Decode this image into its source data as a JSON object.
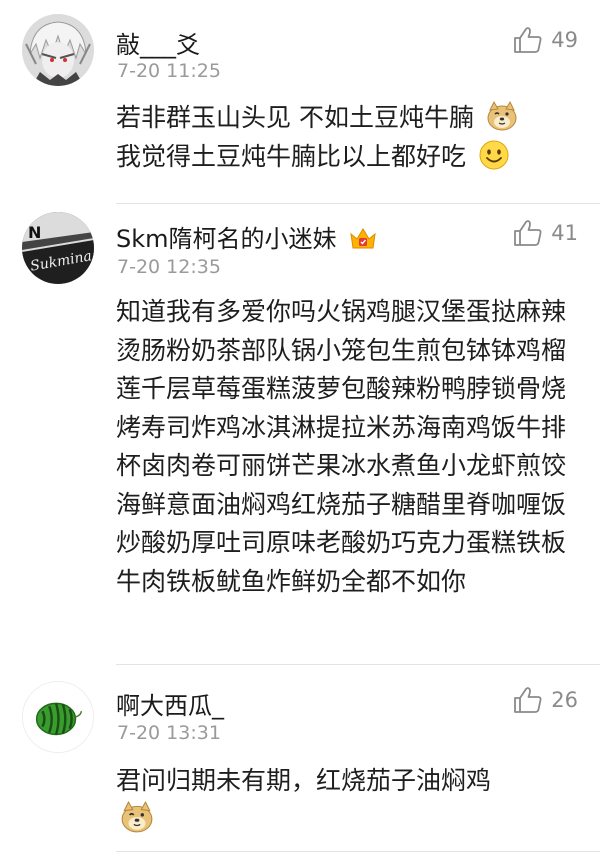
{
  "comments": [
    {
      "username": "敲___爻",
      "timestamp": "7-20 11:25",
      "likes": "49",
      "lines": [
        "若非群玉山头见 不如土豆炖牛腩",
        "我觉得土豆炖牛腩比以上都好吃"
      ],
      "avatar_icon": "anime-avatar",
      "line_emojis": [
        "doge-emoji",
        "smile-emoji"
      ]
    },
    {
      "username": "Skm隋柯名的小迷妹",
      "timestamp": "7-20 12:35",
      "likes": "41",
      "badge_icon": "crown-badge-icon",
      "text": "知道我有多爱你吗火锅鸡腿汉堡蛋挞麻辣烫肠粉奶茶部队锅小笼包生煎包钵钵鸡榴莲千层草莓蛋糕菠萝包酸辣粉鸭脖锁骨烧烤寿司炸鸡冰淇淋提拉米苏海南鸡饭牛排杯卤肉卷可丽饼芒果冰水煮鱼小龙虾煎饺海鲜意面油焖鸡红烧茄子糖醋里脊咖喱饭炒酸奶厚吐司原味老酸奶巧克力蛋糕铁板牛肉铁板鱿鱼炸鲜奶全都不如你",
      "avatar_icon": "logo-avatar"
    },
    {
      "username": "啊大西瓜_",
      "timestamp": "7-20 13:31",
      "likes": "26",
      "text": "君问归期未有期，红烧茄子油焖鸡",
      "avatar_icon": "watermelon-avatar",
      "trailing_emoji": "doge-emoji"
    }
  ],
  "colors": {
    "text": "#1e1e1e",
    "meta": "#9a9a9a",
    "like": "#8a8a8a",
    "divider": "#e3e3e3"
  }
}
